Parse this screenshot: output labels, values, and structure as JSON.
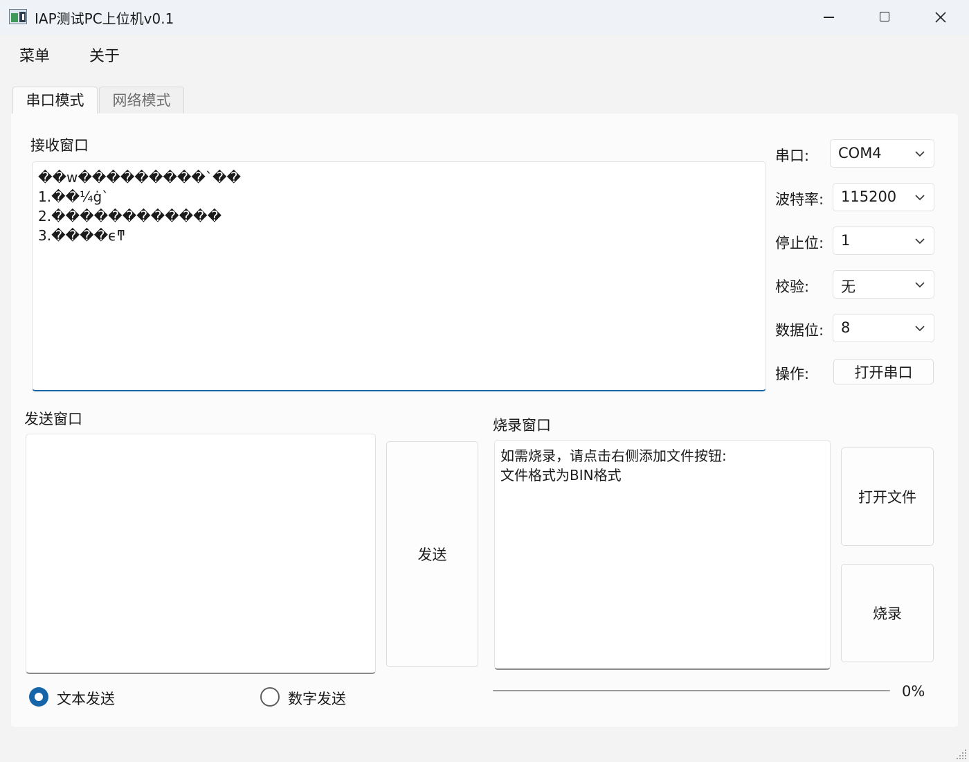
{
  "window": {
    "title": "IAP测试PC上位机v0.1",
    "icons": {
      "app": "app-icon",
      "minimize": "minimize-icon",
      "maximize": "maximize-icon",
      "close": "close-icon"
    }
  },
  "menu": {
    "items": [
      "菜单",
      "关于"
    ]
  },
  "tabs": [
    {
      "label": "串口模式",
      "active": true
    },
    {
      "label": "网络模式",
      "active": false
    }
  ],
  "receive": {
    "label": "接收窗口",
    "text": "��w���������`��\n1.��¼ġ`\n2.������������\n3.����ϵͳ"
  },
  "serial": {
    "port_label": "串口:",
    "port_value": "COM4",
    "baud_label": "波特率:",
    "baud_value": "115200",
    "stopbits_label": "停止位:",
    "stopbits_value": "1",
    "parity_label": "校验:",
    "parity_value": "无",
    "databits_label": "数据位:",
    "databits_value": "8",
    "op_label": "操作:",
    "open_port_button": "打开串口"
  },
  "send": {
    "label": "发送窗口",
    "text": "",
    "send_button": "发送",
    "mode_text": "文本发送",
    "mode_number": "数字发送",
    "selected_mode": "text"
  },
  "burn": {
    "label": "烧录窗口",
    "text": "如需烧录，请点击右侧添加文件按钮:\n文件格式为BIN格式",
    "open_file_button": "打开文件",
    "burn_button": "烧录",
    "progress": 0,
    "progress_text": "0%"
  },
  "colors": {
    "accent": "#1565a8",
    "panel": "#fbfbfb",
    "window_bg": "#f3f3f3"
  }
}
